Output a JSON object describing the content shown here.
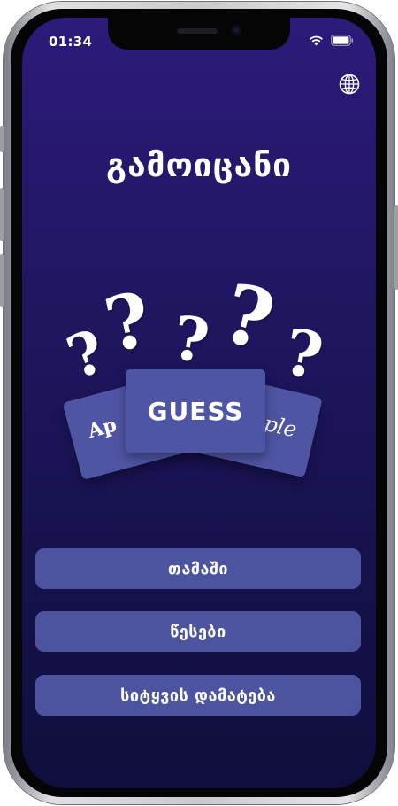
{
  "status_bar": {
    "time": "01:34"
  },
  "header": {
    "language_icon": "globe-icon"
  },
  "app": {
    "title": "გამოიცანი"
  },
  "logo": {
    "main_card": "GUESS",
    "left_card": "Ap",
    "right_card": "ple",
    "question_mark": "?"
  },
  "menu": {
    "play_label": "თამაში",
    "rules_label": "წესები",
    "add_word_label": "სიტყვის დამატება"
  },
  "colors": {
    "background_top": "#2e1a7a",
    "background_bottom": "#100e3d",
    "button": "#4c549f",
    "card": "#4f55a3"
  }
}
